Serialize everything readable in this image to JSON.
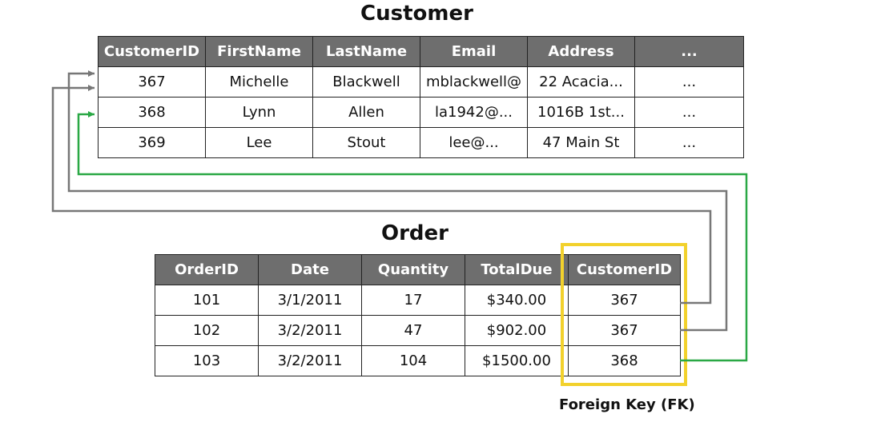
{
  "customer": {
    "title": "Customer",
    "headers": [
      "CustomerID",
      "FirstName",
      "LastName",
      "Email",
      "Address",
      "..."
    ],
    "rows": [
      [
        "367",
        "Michelle",
        "Blackwell",
        "mblackwell@",
        "22 Acacia...",
        "..."
      ],
      [
        "368",
        "Lynn",
        "Allen",
        "la1942@...",
        "1016B 1st...",
        "..."
      ],
      [
        "369",
        "Lee",
        "Stout",
        "lee@...",
        "47 Main St",
        "..."
      ]
    ]
  },
  "order": {
    "title": "Order",
    "headers": [
      "OrderID",
      "Date",
      "Quantity",
      "TotalDue",
      "CustomerID"
    ],
    "rows": [
      [
        "101",
        "3/1/2011",
        "17",
        "$340.00",
        "367"
      ],
      [
        "102",
        "3/2/2011",
        "47",
        "$902.00",
        "367"
      ],
      [
        "103",
        "3/2/2011",
        "104",
        "$1500.00",
        "368"
      ]
    ]
  },
  "foreign_key": {
    "label": "Foreign Key (FK)",
    "highlight_color": "#f2d12c"
  },
  "links": [
    {
      "from_order_row": 0,
      "to_customer_row": 0,
      "color": "#777777"
    },
    {
      "from_order_row": 1,
      "to_customer_row": 0,
      "color": "#777777"
    },
    {
      "from_order_row": 2,
      "to_customer_row": 1,
      "color": "#2aa845"
    }
  ]
}
